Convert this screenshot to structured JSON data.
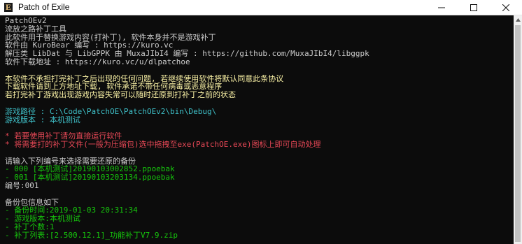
{
  "window": {
    "title": "Patch of Exile",
    "icon_letter": "E",
    "icon": "poe-app-icon",
    "controls": [
      "minimize-icon",
      "maximize-icon",
      "close-icon"
    ]
  },
  "colors": {
    "white": "#cccccc",
    "yellow": "#f9f1a5",
    "cyan": "#3fc1c9",
    "red": "#e74856",
    "green": "#16c60c",
    "background": "#0c0c0c"
  },
  "console": {
    "header": [
      "PatchOEv2",
      "流放之路补丁工具",
      "此软件用于替换游戏内容(打补丁), 软件本身并不是游戏补丁",
      "软件由 KuroBear 编写 : https://kuro.vc",
      "解压类 LibDat 与 LibGPPK 由 MuxaJIbI4 编写 : https://github.com/MuxaJIbI4/libggpk",
      "软件下载地址 : https://kuro.vc/u/dlpatchoe"
    ],
    "disclaimer": [
      "本软件不承担打完补丁之后出现的任何问题, 若继续使用软件将默认同意此条协议",
      "下载软件请到上方地址下载, 软件承诺不带任何病毒或恶意程序",
      "若打完补丁游戏出现游戏内容失常可以随时还原到打补丁之前的状态"
    ],
    "game_info": [
      "游戏路径 : C:\\Code\\PatchOE\\PatchOEv2\\bin\\Debug\\",
      "游戏版本 : 本机测试"
    ],
    "warnings": [
      "* 若要使用补丁请勿直接运行软件",
      "* 将需要打的补丁文件(一般为压缩包)选中拖拽至exe(PatchOE.exe)图标上即可自动处理"
    ],
    "restore_prompt": "请输入下列编号来选择需要还原的备份",
    "backups": [
      "- 000 [本机测试]20190103002852.ppoebak",
      "- 001 [本机测试]20190103203134.ppoebak"
    ],
    "input_line": "编号:001",
    "backup_info_title": "备份包信息如下",
    "backup_info": [
      "- 备份时间:2019-01-03 20:31:34",
      "- 游戏版本:本机测试",
      "- 补丁个数:1",
      "- 补丁列表:[2.500.12.1]_功能补丁V7.9.zip"
    ]
  }
}
